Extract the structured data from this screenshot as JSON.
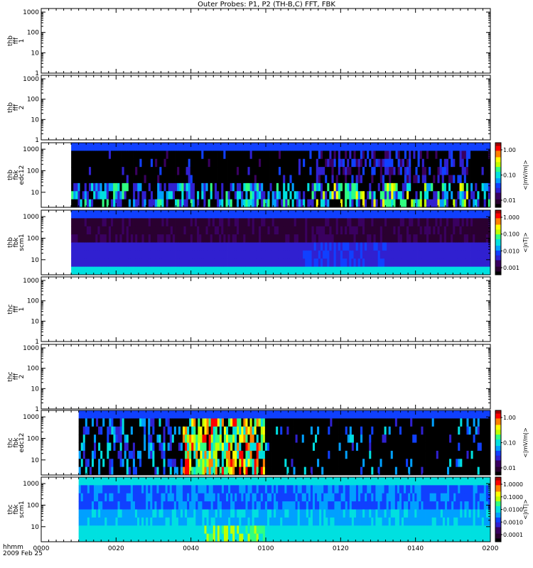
{
  "chart_data": {
    "type": "heatmap",
    "title": "Outer Probes: P1, P2 (TH-B,C) FFT, FBK",
    "x_axis": {
      "ticks": [
        "0000",
        "0020",
        "0040",
        "0100",
        "0120",
        "0140",
        "0200"
      ],
      "minutes": [
        0,
        20,
        40,
        60,
        80,
        100,
        120
      ],
      "range_minutes": [
        0,
        120
      ],
      "label_left_1": "hhmm",
      "label_left_2": "2009 Feb 25"
    },
    "panels": [
      {
        "name": "thb-fff1",
        "label_lines": [
          "thb",
          "fff",
          "1"
        ],
        "yticks": [
          "1000",
          "100",
          "10",
          "1"
        ],
        "ylim": [
          1,
          1500
        ],
        "log_y": true,
        "data_start_minute": null,
        "colorbar": null,
        "pattern": "empty"
      },
      {
        "name": "thb-fff2",
        "label_lines": [
          "thb",
          "fff",
          "2"
        ],
        "yticks": [
          "1000",
          "100",
          "10",
          "1"
        ],
        "ylim": [
          1,
          1500
        ],
        "log_y": true,
        "data_start_minute": null,
        "colorbar": null,
        "pattern": "empty"
      },
      {
        "name": "thb-fbk-edc12",
        "label_lines": [
          "thb",
          "fbk",
          "edc12"
        ],
        "yticks": [
          "1000",
          "100",
          "10"
        ],
        "ylim": [
          2,
          2000
        ],
        "log_y": true,
        "data_start_minute": 8,
        "colorbar": {
          "ticks": [
            "1.00",
            "0.10",
            "0.01"
          ],
          "unit": "<|mV/m|>"
        },
        "pattern": "edc_b",
        "bands": [
          3,
          2,
          2,
          2,
          2,
          1,
          1,
          0
        ]
      },
      {
        "name": "thb-fbk-scm1",
        "label_lines": [
          "thb",
          "fbk",
          "scm1"
        ],
        "yticks": [
          "1000",
          "100",
          "10"
        ],
        "ylim": [
          2,
          2000
        ],
        "log_y": true,
        "data_start_minute": 8,
        "colorbar": {
          "ticks": [
            "1.000",
            "0.100",
            "0.010",
            "0.001"
          ],
          "unit": "<|nT|>"
        },
        "pattern": "scm_b",
        "bands": [
          1,
          1,
          1,
          2,
          2,
          2,
          2,
          4
        ]
      },
      {
        "name": "thc-fff1",
        "label_lines": [
          "thc",
          "fff",
          "1"
        ],
        "yticks": [
          "1000",
          "100",
          "10",
          "1"
        ],
        "ylim": [
          1,
          1500
        ],
        "log_y": true,
        "data_start_minute": null,
        "colorbar": null,
        "pattern": "empty"
      },
      {
        "name": "thc-fff2",
        "label_lines": [
          "thc",
          "fff",
          "2"
        ],
        "yticks": [
          "1000",
          "100",
          "10",
          "1"
        ],
        "ylim": [
          1,
          1500
        ],
        "log_y": true,
        "data_start_minute": null,
        "colorbar": null,
        "pattern": "empty"
      },
      {
        "name": "thc-fbk-edc12",
        "label_lines": [
          "thc",
          "fbk",
          "edc12"
        ],
        "yticks": [
          "1000",
          "100",
          "10"
        ],
        "ylim": [
          2,
          2000
        ],
        "log_y": true,
        "data_start_minute": 10,
        "colorbar": {
          "ticks": [
            "1.00",
            "0.10",
            "0.01"
          ],
          "unit": "<|mV/m|>"
        },
        "pattern": "edc_c",
        "bands": [
          3,
          2,
          2,
          2,
          2,
          1,
          1,
          0
        ]
      },
      {
        "name": "thc-fbk-scm1",
        "label_lines": [
          "thc",
          "fbk",
          "scm1"
        ],
        "yticks": [
          "1000",
          "100",
          "10"
        ],
        "ylim": [
          2,
          2000
        ],
        "log_y": true,
        "data_start_minute": 10,
        "colorbar": {
          "ticks": [
            "1.0000",
            "0.1000",
            "0.0100",
            "0.0010",
            "0.0001"
          ],
          "unit": "<|nT|>"
        },
        "pattern": "scm_c",
        "bands": [
          4,
          3,
          3,
          3,
          4,
          4,
          5,
          6
        ]
      }
    ],
    "colors": {
      "axis": "#000000",
      "scale": [
        "#000000",
        "#2a0030",
        "#3a0060",
        "#3020d0",
        "#1040ff",
        "#00a0ff",
        "#00e0e0",
        "#30ff80",
        "#c0ff00",
        "#ffff00",
        "#ff8000",
        "#ff0000",
        "#a00000"
      ]
    }
  }
}
